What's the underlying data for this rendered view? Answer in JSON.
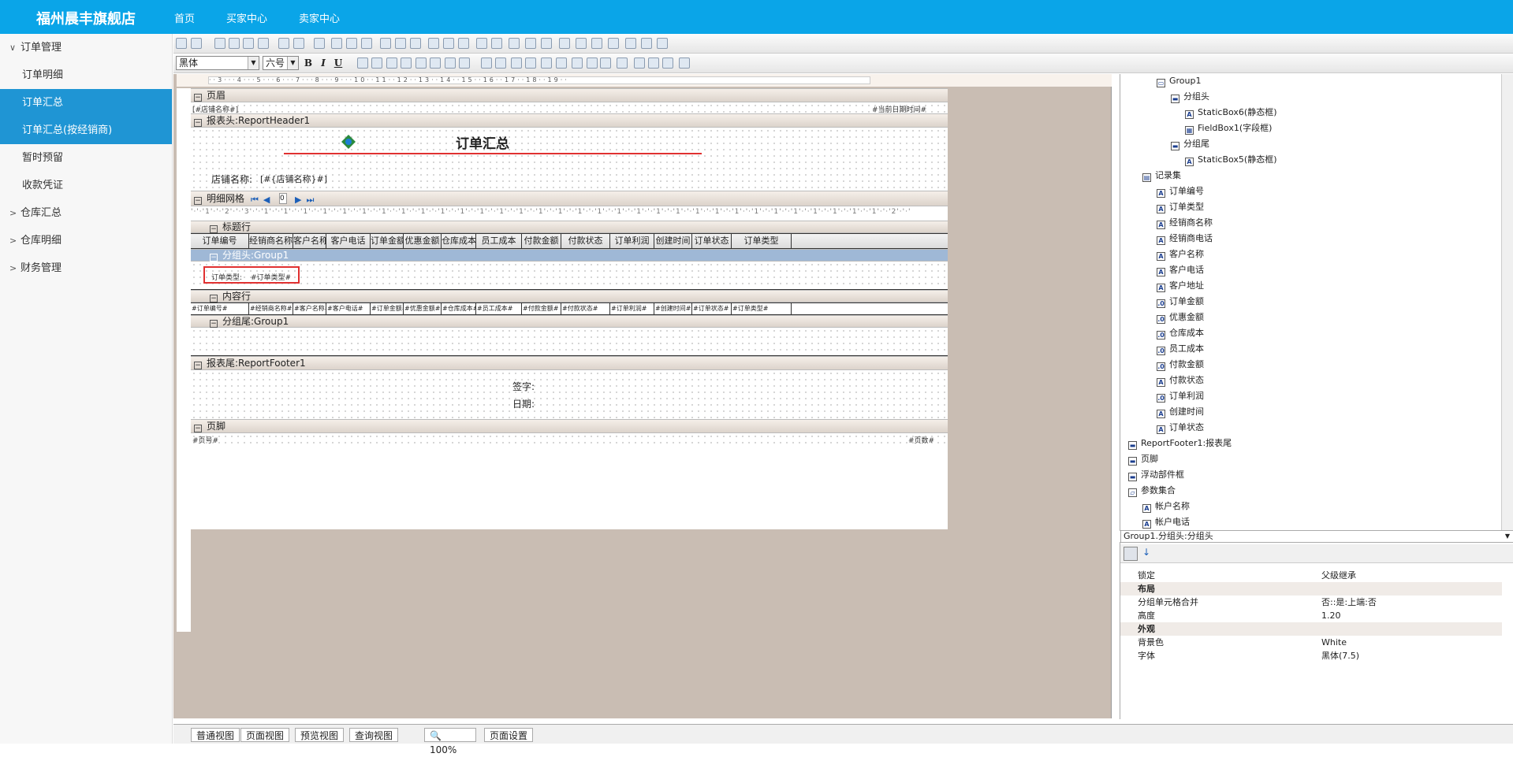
{
  "header": {
    "brand": "福州晨丰旗舰店",
    "nav": [
      "首页",
      "买家中心",
      "卖家中心"
    ]
  },
  "sidebar": {
    "items": [
      {
        "label": "订单管理",
        "kind": "group"
      },
      {
        "label": "订单明细",
        "kind": "item"
      },
      {
        "label": "订单汇总",
        "kind": "selected"
      },
      {
        "label": "订单汇总(按经销商)",
        "kind": "selected"
      },
      {
        "label": "暂时预留",
        "kind": "item"
      },
      {
        "label": "收款凭证",
        "kind": "item"
      },
      {
        "label": "仓库汇总",
        "kind": "group"
      },
      {
        "label": "仓库明细",
        "kind": "group"
      },
      {
        "label": "财务管理",
        "kind": "group"
      }
    ]
  },
  "toolbar": {
    "font_name": "黑体",
    "font_size": "六号",
    "bold": "B",
    "italic": "I",
    "underline": "U"
  },
  "report": {
    "page_header": "页眉",
    "shop_name_field": "[#店铺名称#]",
    "current_date_field": "#当前日期时间#",
    "report_header": "报表头:ReportHeader1",
    "title": "订单汇总",
    "shop_label": "店铺名称:",
    "shop_value": "[#{店铺名称}#]",
    "grid_band": "明细网格",
    "page_num": "0",
    "title_row": "标题行",
    "columns": [
      "订单编号",
      "经销商名称",
      "客户名称",
      "客户电话",
      "订单金额",
      "优惠金额",
      "仓库成本",
      "员工成本",
      "付款金额",
      "付款状态",
      "订单利润",
      "创建时间",
      "订单状态",
      "订单类型"
    ],
    "group_header": "分组头:Group1",
    "group_label": "订单类型:",
    "group_value": "#订单类型#",
    "content_row": "内容行",
    "data_fields": [
      "#订单编号#",
      "#经销商名称#",
      "#客户名称#",
      "#客户电话#",
      "#订单金额#",
      "#优惠金额#",
      "#仓库成本#",
      "#员工成本#",
      "#付款金额#",
      "#付款状态#",
      "#订单利润#",
      "#创建时间#",
      "#订单状态#",
      "#订单类型#"
    ],
    "group_footer": "分组尾:Group1",
    "report_footer": "报表尾:ReportFooter1",
    "sign": "签字:",
    "date": "日期:",
    "page_footer": "页脚",
    "page_no": "#页号#",
    "page_count": "#页数#"
  },
  "tree": {
    "items": [
      {
        "label": "Group1",
        "level": 2,
        "icon": "group"
      },
      {
        "label": "分组头",
        "level": 3,
        "icon": "band"
      },
      {
        "label": "StaticBox6(静态框)",
        "level": 4,
        "icon": "A"
      },
      {
        "label": "FieldBox1(字段框)",
        "level": 4,
        "icon": "field"
      },
      {
        "label": "分组尾",
        "level": 3,
        "icon": "band"
      },
      {
        "label": "StaticBox5(静态框)",
        "level": 4,
        "icon": "A"
      },
      {
        "label": "记录集",
        "level": 1,
        "icon": "rs"
      },
      {
        "label": "订单编号",
        "level": 2,
        "icon": "A"
      },
      {
        "label": "订单类型",
        "level": 2,
        "icon": "A"
      },
      {
        "label": "经销商名称",
        "level": 2,
        "icon": "A"
      },
      {
        "label": "经销商电话",
        "level": 2,
        "icon": "A"
      },
      {
        "label": "客户名称",
        "level": 2,
        "icon": "A"
      },
      {
        "label": "客户电话",
        "level": 2,
        "icon": "A"
      },
      {
        "label": "客户地址",
        "level": 2,
        "icon": "A"
      },
      {
        "label": "订单金额",
        "level": 2,
        "icon": ".0"
      },
      {
        "label": "优惠金额",
        "level": 2,
        "icon": ".0"
      },
      {
        "label": "仓库成本",
        "level": 2,
        "icon": ".0"
      },
      {
        "label": "员工成本",
        "level": 2,
        "icon": ".0"
      },
      {
        "label": "付款金额",
        "level": 2,
        "icon": ".0"
      },
      {
        "label": "付款状态",
        "level": 2,
        "icon": "A"
      },
      {
        "label": "订单利润",
        "level": 2,
        "icon": ".0"
      },
      {
        "label": "创建时间",
        "level": 2,
        "icon": "A"
      },
      {
        "label": "订单状态",
        "level": 2,
        "icon": "A"
      },
      {
        "label": "ReportFooter1:报表尾",
        "level": 0,
        "icon": "band"
      },
      {
        "label": "页脚",
        "level": 0,
        "icon": "band"
      },
      {
        "label": "浮动部件框",
        "level": 0,
        "icon": "band"
      },
      {
        "label": "参数集合",
        "level": 0,
        "icon": "folder"
      },
      {
        "label": "帐户名称",
        "level": 1,
        "icon": "A"
      },
      {
        "label": "帐户电话",
        "level": 1,
        "icon": "A"
      }
    ]
  },
  "props": {
    "object": "Group1.分组头:分组头",
    "rows": [
      {
        "k": "锁定",
        "v": "父级继承",
        "cat": false
      },
      {
        "k": "布局",
        "v": "",
        "cat": true
      },
      {
        "k": "分组单元格合并",
        "v": "否::是:上端:否",
        "cat": false
      },
      {
        "k": "高度",
        "v": "1.20",
        "cat": false
      },
      {
        "k": "外观",
        "v": "",
        "cat": true
      },
      {
        "k": "背景色",
        "v": "White",
        "cat": false
      },
      {
        "k": "字体",
        "v": "黑体(7.5)",
        "cat": false
      }
    ]
  },
  "bottom_tabs": [
    "普通视图",
    "页面视图",
    "预览视图",
    "查询视图"
  ],
  "zoom": "100%",
  "page_setup": "页面设置"
}
